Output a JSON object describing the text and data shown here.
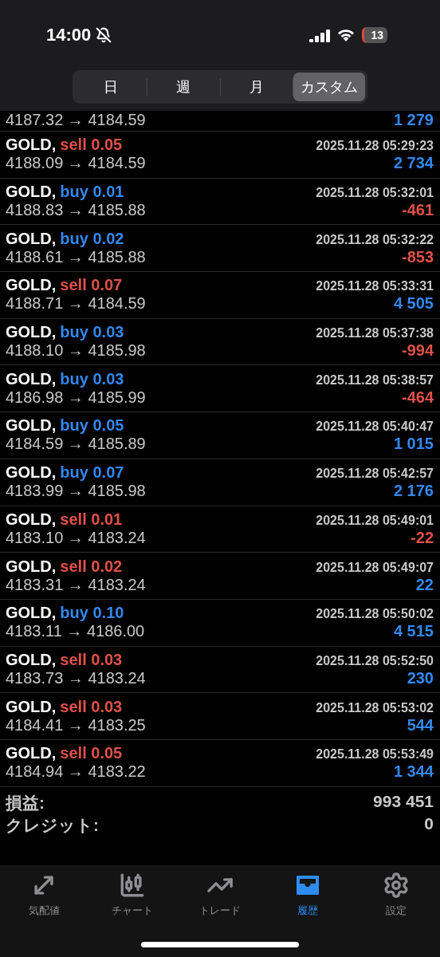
{
  "status_bar": {
    "time": "14:00",
    "silent": true,
    "battery": "13"
  },
  "period_tabs": [
    {
      "label": "日",
      "selected": false
    },
    {
      "label": "週",
      "selected": false
    },
    {
      "label": "月",
      "selected": false
    },
    {
      "label": "カスタム",
      "selected": true
    }
  ],
  "partial_row": {
    "prices": "4187.32 → 4184.59",
    "profit": {
      "text": "1 279",
      "kind": "gain"
    }
  },
  "deals": [
    {
      "symbol": "GOLD,",
      "order": {
        "text": "sell 0.05",
        "kind": "sell"
      },
      "time": "2025.11.28 05:29:23",
      "prices": "4188.09 → 4184.59",
      "profit": {
        "text": "2 734",
        "kind": "gain"
      }
    },
    {
      "symbol": "GOLD,",
      "order": {
        "text": "buy 0.01",
        "kind": "buy"
      },
      "time": "2025.11.28 05:32:01",
      "prices": "4188.83 → 4185.88",
      "profit": {
        "text": "-461",
        "kind": "loss"
      }
    },
    {
      "symbol": "GOLD,",
      "order": {
        "text": "buy 0.02",
        "kind": "buy"
      },
      "time": "2025.11.28 05:32:22",
      "prices": "4188.61 → 4185.88",
      "profit": {
        "text": "-853",
        "kind": "loss"
      }
    },
    {
      "symbol": "GOLD,",
      "order": {
        "text": "sell 0.07",
        "kind": "sell"
      },
      "time": "2025.11.28 05:33:31",
      "prices": "4188.71 → 4184.59",
      "profit": {
        "text": "4 505",
        "kind": "gain"
      }
    },
    {
      "symbol": "GOLD,",
      "order": {
        "text": "buy 0.03",
        "kind": "buy"
      },
      "time": "2025.11.28 05:37:38",
      "prices": "4188.10 → 4185.98",
      "profit": {
        "text": "-994",
        "kind": "loss"
      }
    },
    {
      "symbol": "GOLD,",
      "order": {
        "text": "buy 0.03",
        "kind": "buy"
      },
      "time": "2025.11.28 05:38:57",
      "prices": "4186.98 → 4185.99",
      "profit": {
        "text": "-464",
        "kind": "loss"
      }
    },
    {
      "symbol": "GOLD,",
      "order": {
        "text": "buy 0.05",
        "kind": "buy"
      },
      "time": "2025.11.28 05:40:47",
      "prices": "4184.59 → 4185.89",
      "profit": {
        "text": "1 015",
        "kind": "gain"
      }
    },
    {
      "symbol": "GOLD,",
      "order": {
        "text": "buy 0.07",
        "kind": "buy"
      },
      "time": "2025.11.28 05:42:57",
      "prices": "4183.99 → 4185.98",
      "profit": {
        "text": "2 176",
        "kind": "gain"
      }
    },
    {
      "symbol": "GOLD,",
      "order": {
        "text": "sell 0.01",
        "kind": "sell"
      },
      "time": "2025.11.28 05:49:01",
      "prices": "4183.10 → 4183.24",
      "profit": {
        "text": "-22",
        "kind": "loss"
      }
    },
    {
      "symbol": "GOLD,",
      "order": {
        "text": "sell 0.02",
        "kind": "sell"
      },
      "time": "2025.11.28 05:49:07",
      "prices": "4183.31 → 4183.24",
      "profit": {
        "text": "22",
        "kind": "gain"
      }
    },
    {
      "symbol": "GOLD,",
      "order": {
        "text": "buy 0.10",
        "kind": "buy"
      },
      "time": "2025.11.28 05:50:02",
      "prices": "4183.11 → 4186.00",
      "profit": {
        "text": "4 515",
        "kind": "gain"
      }
    },
    {
      "symbol": "GOLD,",
      "order": {
        "text": "sell 0.03",
        "kind": "sell"
      },
      "time": "2025.11.28 05:52:50",
      "prices": "4183.73 → 4183.24",
      "profit": {
        "text": "230",
        "kind": "gain"
      }
    },
    {
      "symbol": "GOLD,",
      "order": {
        "text": "sell 0.03",
        "kind": "sell"
      },
      "time": "2025.11.28 05:53:02",
      "prices": "4184.41 → 4183.25",
      "profit": {
        "text": "544",
        "kind": "gain"
      }
    },
    {
      "symbol": "GOLD,",
      "order": {
        "text": "sell 0.05",
        "kind": "sell"
      },
      "time": "2025.11.28 05:53:49",
      "prices": "4184.94 → 4183.22",
      "profit": {
        "text": "1 344",
        "kind": "gain"
      }
    }
  ],
  "totals": [
    {
      "label": "損益:",
      "value": "993 451"
    },
    {
      "label": "クレジット:",
      "value": "0"
    }
  ],
  "tab_bar": [
    {
      "kind": "quotes",
      "label": "気配値",
      "selected": false
    },
    {
      "kind": "chart",
      "label": "チャート",
      "selected": false
    },
    {
      "kind": "trade",
      "label": "トレード",
      "selected": false
    },
    {
      "kind": "history",
      "label": "履歴",
      "selected": true
    },
    {
      "kind": "settings",
      "label": "設定",
      "selected": false
    }
  ]
}
